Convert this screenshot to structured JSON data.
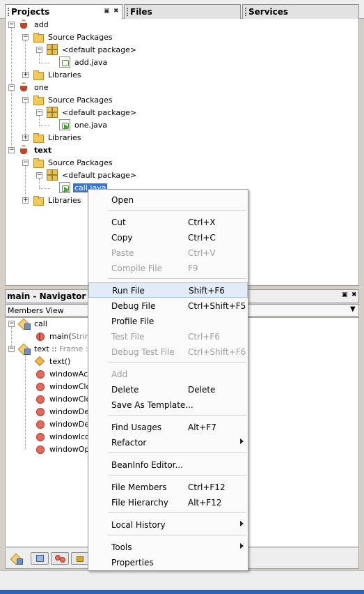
{
  "tabs": [
    {
      "label": "Projects",
      "active": true
    },
    {
      "label": "Files",
      "active": false
    },
    {
      "label": "Services",
      "active": false
    }
  ],
  "projects": {
    "add": {
      "name": "add",
      "source": "Source Packages",
      "pkg": "<default package>",
      "file": "add.java",
      "libs": "Libraries"
    },
    "one": {
      "name": "one",
      "source": "Source Packages",
      "pkg": "<default package>",
      "file": "one.java",
      "libs": "Libraries"
    },
    "text": {
      "name": "text",
      "source": "Source Packages",
      "pkg": "<default package>",
      "file": "call.java",
      "libs": "Libraries"
    }
  },
  "navigator": {
    "title": "main - Navigator",
    "view": "Members View",
    "items": [
      {
        "label": "call",
        "suffix": ""
      },
      {
        "label": "main(",
        "suffix": "String"
      },
      {
        "label": "text :: ",
        "suffix": "Frame :"
      },
      {
        "label": "text()",
        "suffix": ""
      },
      {
        "label": "windowActi",
        "suffix": ""
      },
      {
        "label": "windowClos",
        "suffix": ""
      },
      {
        "label": "windowClos",
        "suffix": ""
      },
      {
        "label": "windowDea",
        "suffix": ""
      },
      {
        "label": "windowDeic",
        "suffix": ""
      },
      {
        "label": "windowIcon",
        "suffix": ""
      },
      {
        "label": "windowOpe",
        "suffix": ""
      }
    ]
  },
  "menu": {
    "items": [
      {
        "label": "Open",
        "shortcut": ""
      },
      {
        "label": "Cut",
        "shortcut": "Ctrl+X"
      },
      {
        "label": "Copy",
        "shortcut": "Ctrl+C"
      },
      {
        "label": "Paste",
        "shortcut": "Ctrl+V"
      },
      {
        "label": "Compile File",
        "shortcut": "F9"
      },
      {
        "label": "Run File",
        "shortcut": "Shift+F6"
      },
      {
        "label": "Debug File",
        "shortcut": "Ctrl+Shift+F5"
      },
      {
        "label": "Profile File",
        "shortcut": ""
      },
      {
        "label": "Test File",
        "shortcut": "Ctrl+F6"
      },
      {
        "label": "Debug Test File",
        "shortcut": "Ctrl+Shift+F6"
      },
      {
        "label": "Add",
        "shortcut": ""
      },
      {
        "label": "Delete",
        "shortcut": "Delete"
      },
      {
        "label": "Save As Template...",
        "shortcut": ""
      },
      {
        "label": "Find Usages",
        "shortcut": "Alt+F7"
      },
      {
        "label": "Refactor",
        "shortcut": ""
      },
      {
        "label": "BeanInfo Editor...",
        "shortcut": ""
      },
      {
        "label": "File Members",
        "shortcut": "Ctrl+F12"
      },
      {
        "label": "File Hierarchy",
        "shortcut": "Alt+F12"
      },
      {
        "label": "Local History",
        "shortcut": ""
      },
      {
        "label": "Tools",
        "shortcut": ""
      },
      {
        "label": "Properties",
        "shortcut": ""
      }
    ]
  },
  "colors": {
    "selection": "#3875d7",
    "menu_hover": "#e2ecf8",
    "accent": "#2e63b8"
  }
}
